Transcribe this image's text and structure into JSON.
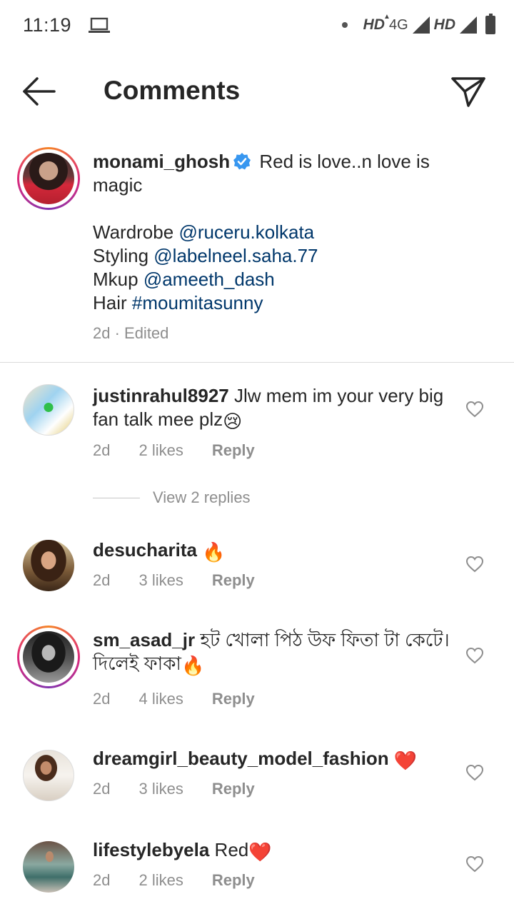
{
  "status": {
    "time": "11:19",
    "hd1": "HD",
    "net": "4G",
    "hd2": "HD"
  },
  "header": {
    "title": "Comments"
  },
  "caption": {
    "username": "monami_ghosh",
    "text_line1": "Red is love..n love is magic",
    "wardrobe_label": "Wardrobe",
    "wardrobe_mention": "@ruceru.kolkata",
    "styling_label": "Styling",
    "styling_mention": "@labelneel.saha.77",
    "mkup_label": "Mkup",
    "mkup_mention": "@ameeth_dash",
    "hair_label": "Hair",
    "hair_tag": "#moumitasunny",
    "meta": "2d · Edited"
  },
  "comments": [
    {
      "username": "justinrahul8927",
      "text": "Jlw mem im your very big fan talk mee plz",
      "emoji": "😢",
      "time": "2d",
      "likes": "2 likes",
      "reply": "Reply"
    },
    {
      "username": "desucharita",
      "text": "",
      "emoji": "🔥",
      "time": "2d",
      "likes": "3 likes",
      "reply": "Reply"
    },
    {
      "username": "sm_asad_jr",
      "text": "হট খোলা পিঠ উফ ফিতা টা কেটে।দিলেই ফাকা",
      "emoji": "🔥",
      "time": "2d",
      "likes": "4 likes",
      "reply": "Reply"
    },
    {
      "username": "dreamgirl_beauty_model_fashion",
      "text": "",
      "emoji": "❤️",
      "time": "2d",
      "likes": "3 likes",
      "reply": "Reply"
    },
    {
      "username": "lifestylebyela",
      "text": "Red",
      "emoji": "❤️",
      "time": "2d",
      "likes": "2 likes",
      "reply": "Reply"
    }
  ],
  "view_replies": "View 2 replies",
  "icons": {
    "back": "back-arrow-icon",
    "send": "direct-send-icon",
    "heart": "heart-outline-icon",
    "verified": "verified-badge-icon"
  },
  "colors": {
    "text": "#262626",
    "muted": "#8e8e8e",
    "mention": "#00376b",
    "verified": "#3897f0"
  }
}
